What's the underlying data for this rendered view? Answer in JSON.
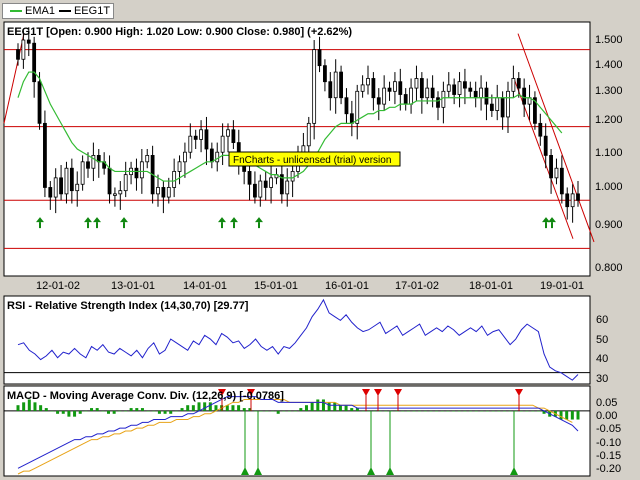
{
  "legend": {
    "items": [
      {
        "label": "EMA1",
        "color": "#33bb33"
      },
      {
        "label": "EEG1T",
        "color": "#000000"
      }
    ]
  },
  "price_panel": {
    "title": "EEG1T [Open: 0.900  High: 1.020  Low: 0.900  Close: 0.980] (+2.62%)",
    "watermark": "FnCharts - unlicensed (trial) version",
    "y_ticks": [
      "1.500",
      "1.400",
      "1.300",
      "1.200",
      "1.100",
      "1.000",
      "0.900",
      "0.800"
    ],
    "x_ticks": [
      "12-01-02",
      "13-01-01",
      "14-01-01",
      "15-01-01",
      "16-01-01",
      "17-01-02",
      "18-01-01",
      "19-01-01"
    ]
  },
  "rsi_panel": {
    "title": "RSI - Relative Strength Index (14,30,70) [29.77]",
    "y_ticks": [
      "60",
      "50",
      "40",
      "30"
    ]
  },
  "macd_panel": {
    "title": "MACD - Moving Average Conv. Div. (12,26,9) [-0.0786]",
    "y_ticks": [
      "0.05",
      "0.00",
      "-0.05",
      "-0.10",
      "-0.15",
      "-0.20"
    ]
  },
  "chart_data": [
    {
      "type": "candlestick",
      "title": "EEG1T [Open: 0.900  High: 1.020  Low: 0.900  Close: 0.980] (+2.62%)",
      "ylim": [
        0.75,
        1.53
      ],
      "x_labels": [
        "12-01-02",
        "13-01-01",
        "14-01-01",
        "15-01-01",
        "16-01-01",
        "17-01-02",
        "18-01-01",
        "19-01-01"
      ],
      "close": [
        1.42,
        1.48,
        1.47,
        1.35,
        1.22,
        1.02,
        0.99,
        1.05,
        1.0,
        1.08,
        1.01,
        1.03,
        1.1,
        1.08,
        1.12,
        1.1,
        1.08,
        1.0,
        1.0,
        1.01,
        1.06,
        1.08,
        1.05,
        1.1,
        1.12,
        1.0,
        1.02,
        0.99,
        1.02,
        1.07,
        1.1,
        1.13,
        1.18,
        1.17,
        1.2,
        1.14,
        1.1,
        1.13,
        1.18,
        1.2,
        1.16,
        1.09,
        1.07,
        1.03,
        0.99,
        1.04,
        1.02,
        1.05,
        1.06,
        1.0,
        1.04,
        1.07,
        1.12,
        1.15,
        1.22,
        1.45,
        1.4,
        1.35,
        1.3,
        1.38,
        1.3,
        1.25,
        1.22,
        1.32,
        1.34,
        1.36,
        1.3,
        1.28,
        1.33,
        1.32,
        1.35,
        1.31,
        1.28,
        1.33,
        1.36,
        1.3,
        1.33,
        1.3,
        1.27,
        1.32,
        1.34,
        1.31,
        1.35,
        1.33,
        1.32,
        1.3,
        1.33,
        1.28,
        1.26,
        1.3,
        1.24,
        1.32,
        1.36,
        1.33,
        1.28,
        1.3,
        1.22,
        1.18,
        1.12,
        1.05,
        1.08,
        1.0,
        0.96,
        1.0,
        0.98
      ],
      "ema": [
        1.3,
        1.35,
        1.38,
        1.38,
        1.36,
        1.32,
        1.28,
        1.25,
        1.22,
        1.19,
        1.16,
        1.14,
        1.13,
        1.12,
        1.11,
        1.1,
        1.1,
        1.08,
        1.07,
        1.07,
        1.07,
        1.07,
        1.07,
        1.07,
        1.07,
        1.06,
        1.05,
        1.04,
        1.04,
        1.04,
        1.05,
        1.06,
        1.07,
        1.08,
        1.09,
        1.1,
        1.1,
        1.11,
        1.12,
        1.12,
        1.12,
        1.12,
        1.11,
        1.1,
        1.09,
        1.08,
        1.07,
        1.06,
        1.06,
        1.05,
        1.05,
        1.05,
        1.06,
        1.07,
        1.09,
        1.11,
        1.14,
        1.17,
        1.19,
        1.21,
        1.22,
        1.22,
        1.22,
        1.23,
        1.24,
        1.25,
        1.25,
        1.26,
        1.26,
        1.27,
        1.27,
        1.28,
        1.28,
        1.28,
        1.29,
        1.29,
        1.29,
        1.29,
        1.29,
        1.3,
        1.3,
        1.3,
        1.3,
        1.3,
        1.3,
        1.3,
        1.3,
        1.3,
        1.3,
        1.3,
        1.3,
        1.3,
        1.3,
        1.31,
        1.3,
        1.3,
        1.29,
        1.27,
        1.25,
        1.23,
        1.21,
        1.19
      ]
    },
    {
      "type": "line",
      "title": "RSI - Relative Strength Index (14,30,70) [29.77]",
      "ylim": [
        25,
        70
      ],
      "values": [
        45,
        46,
        42,
        40,
        37,
        39,
        42,
        38,
        41,
        40,
        43,
        40,
        38,
        44,
        42,
        45,
        41,
        40,
        43,
        41,
        39,
        42,
        38,
        43,
        46,
        40,
        42,
        48,
        46,
        44,
        42,
        47,
        45,
        50,
        48,
        45,
        51,
        49,
        46,
        47,
        43,
        45,
        48,
        44,
        42,
        44,
        40,
        44,
        43,
        46,
        50,
        54,
        60,
        64,
        69,
        62,
        60,
        58,
        61,
        57,
        54,
        52,
        53,
        55,
        57,
        51,
        53,
        55,
        50,
        52,
        54,
        56,
        50,
        52,
        54,
        52,
        55,
        53,
        50,
        52,
        54,
        52,
        55,
        50,
        52,
        53,
        49,
        45,
        48,
        53,
        56,
        54,
        52,
        40,
        33,
        31,
        30,
        28,
        26,
        29
      ]
    },
    {
      "type": "bar+line",
      "title": "MACD - Moving Average Conv. Div. (12,26,9) [-0.0786]",
      "ylim": [
        -0.22,
        0.08
      ],
      "histogram": [
        0.02,
        0.03,
        0.04,
        0.03,
        0.02,
        0.01,
        0.0,
        -0.01,
        -0.01,
        -0.02,
        -0.02,
        -0.01,
        0.0,
        0.01,
        0.01,
        0.0,
        -0.01,
        -0.01,
        0.0,
        0.0,
        0.01,
        0.01,
        0.01,
        0.0,
        0.0,
        -0.01,
        -0.01,
        -0.01,
        0.0,
        0.01,
        0.02,
        0.02,
        0.03,
        0.03,
        0.03,
        0.02,
        0.02,
        0.02,
        0.02,
        0.02,
        0.01,
        0.01,
        0.0,
        0.0,
        0.0,
        0.0,
        -0.01,
        0.0,
        0.0,
        0.0,
        0.01,
        0.02,
        0.03,
        0.04,
        0.04,
        0.03,
        0.03,
        0.02,
        0.02,
        0.01,
        0.01,
        0.0,
        0.0,
        0.0,
        0.0,
        0.0,
        0.0,
        0.0,
        0.0,
        0.0,
        0.0,
        0.0,
        0.0,
        0.0,
        0.0,
        0.0,
        0.0,
        0.0,
        0.0,
        0.0,
        0.0,
        0.0,
        0.0,
        0.0,
        0.0,
        0.0,
        0.0,
        0.0,
        0.0,
        0.0,
        0.0,
        0.0,
        0.0,
        -0.01,
        -0.02,
        -0.02,
        -0.03,
        -0.03,
        -0.03,
        -0.03
      ],
      "macd": [
        -0.2,
        -0.19,
        -0.18,
        -0.17,
        -0.16,
        -0.15,
        -0.14,
        -0.13,
        -0.12,
        -0.11,
        -0.1,
        -0.1,
        -0.09,
        -0.09,
        -0.08,
        -0.08,
        -0.07,
        -0.07,
        -0.06,
        -0.06,
        -0.05,
        -0.05,
        -0.04,
        -0.04,
        -0.03,
        -0.03,
        -0.03,
        -0.02,
        -0.02,
        -0.02,
        -0.01,
        -0.01,
        0.0,
        0.01,
        0.02,
        0.03,
        0.04,
        0.05,
        0.05,
        0.05,
        0.05,
        0.05,
        0.05,
        0.04,
        0.04,
        0.04,
        0.03,
        0.03,
        0.03,
        0.03,
        0.03,
        0.03,
        0.03,
        0.03,
        0.03,
        0.02,
        0.02,
        0.02,
        0.02,
        0.02,
        0.01,
        0.01,
        0.01,
        0.01,
        0.01,
        0.01,
        0.01,
        0.01,
        0.01,
        0.01,
        0.01,
        0.01,
        0.01,
        0.01,
        0.01,
        0.01,
        0.01,
        0.01,
        0.01,
        0.01,
        0.01,
        0.01,
        0.01,
        0.01,
        0.01,
        0.01,
        0.01,
        0.01,
        0.01,
        0.01,
        0.01,
        0.01,
        0.01,
        0.0,
        -0.01,
        -0.02,
        -0.03,
        -0.04,
        -0.05,
        -0.07
      ],
      "signal": [
        -0.22,
        -0.21,
        -0.21,
        -0.2,
        -0.19,
        -0.18,
        -0.17,
        -0.16,
        -0.15,
        -0.14,
        -0.13,
        -0.12,
        -0.11,
        -0.1,
        -0.1,
        -0.09,
        -0.09,
        -0.08,
        -0.08,
        -0.07,
        -0.07,
        -0.06,
        -0.06,
        -0.05,
        -0.05,
        -0.04,
        -0.04,
        -0.04,
        -0.03,
        -0.03,
        -0.03,
        -0.02,
        -0.02,
        -0.01,
        -0.01,
        0.0,
        0.01,
        0.02,
        0.03,
        0.03,
        0.04,
        0.04,
        0.04,
        0.04,
        0.04,
        0.04,
        0.04,
        0.04,
        0.03,
        0.03,
        0.03,
        0.03,
        0.03,
        0.03,
        0.03,
        0.03,
        0.03,
        0.02,
        0.02,
        0.02,
        0.02,
        0.02,
        0.02,
        0.02,
        0.02,
        0.02,
        0.02,
        0.02,
        0.02,
        0.02,
        0.02,
        0.02,
        0.02,
        0.02,
        0.02,
        0.02,
        0.02,
        0.02,
        0.02,
        0.02,
        0.02,
        0.02,
        0.02,
        0.02,
        0.02,
        0.02,
        0.02,
        0.02,
        0.02,
        0.02,
        0.02,
        0.02,
        0.01,
        0.01,
        0.0,
        -0.01,
        -0.02,
        -0.03,
        -0.04
      ]
    }
  ]
}
